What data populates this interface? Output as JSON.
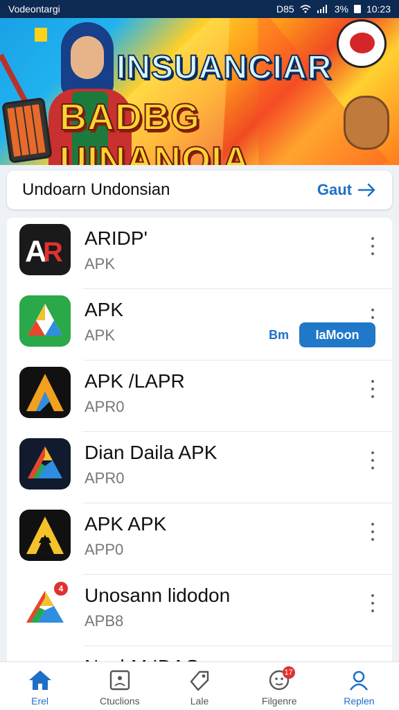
{
  "status_bar": {
    "carrier": "Vodeontargi",
    "icons_text": "D85",
    "battery": "3%",
    "time": "10:23"
  },
  "banner": {
    "title_line1": "INSUANCIAR",
    "title_line2": "BADBG UINANOIA"
  },
  "search": {
    "query": "Undoarn Undonsian",
    "action_label": "Gaut"
  },
  "apps": [
    {
      "name": "ARIDP'",
      "sub": "APK"
    },
    {
      "name": "APK",
      "sub": "APK",
      "link": "Bm",
      "button": "IaMoon"
    },
    {
      "name": "APK /LAPR",
      "sub": "APR0"
    },
    {
      "name": "Dian Daila APK",
      "sub": "APR0"
    },
    {
      "name": "APK APK",
      "sub": "APP0"
    },
    {
      "name": "Unosann lidodon",
      "sub": "APB8",
      "badge": "4"
    },
    {
      "name": "NoabM IDAG",
      "sub": ""
    }
  ],
  "nav": [
    {
      "label": "Erel"
    },
    {
      "label": "Ctuclions"
    },
    {
      "label": "Lale"
    },
    {
      "label": "Filgenre",
      "badge": "17"
    },
    {
      "label": "Replen"
    }
  ],
  "colors": {
    "accent": "#1f6fc6",
    "status_bar": "#0d2a52"
  }
}
